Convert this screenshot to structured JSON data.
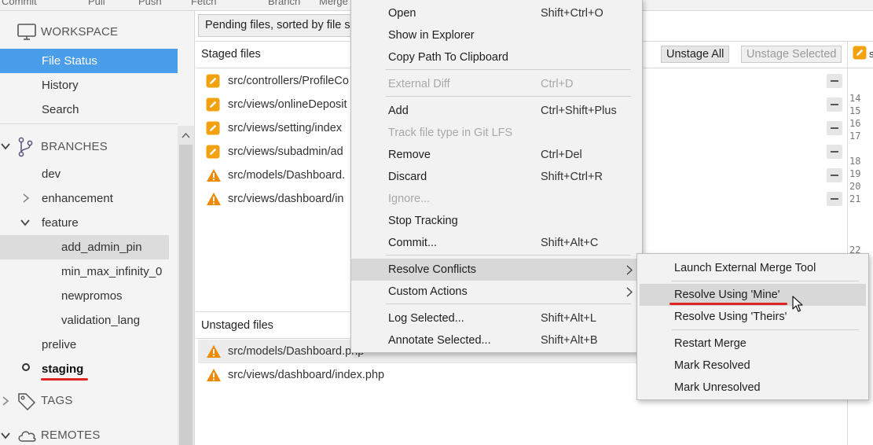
{
  "toolbar": {
    "items": [
      "Commit",
      "Pull",
      "Push",
      "Fetch",
      "Branch",
      "Merge"
    ]
  },
  "sidebar": {
    "workspace": {
      "label": "WORKSPACE",
      "items": [
        "File Status",
        "History",
        "Search"
      ],
      "selected": "File Status"
    },
    "branches": {
      "label": "BRANCHES",
      "items": {
        "dev": "dev",
        "enhancement": "enhancement",
        "feature": "feature",
        "feature_children": [
          "add_admin_pin",
          "min_max_infinity_0",
          "newpromos",
          "validation_lang"
        ],
        "prelive": "prelive",
        "staging": "staging"
      },
      "current": "staging"
    },
    "tags": {
      "label": "TAGS"
    },
    "remotes": {
      "label": "REMOTES"
    }
  },
  "main": {
    "filter_label": "Pending files, sorted by file s",
    "staged": {
      "title": "Staged files",
      "unstage_all": "Unstage All",
      "unstage_selected": "Unstage Selected",
      "files": [
        {
          "path": "src/controllers/ProfileCo",
          "status": "modified"
        },
        {
          "path": "src/views/onlineDeposit",
          "status": "modified"
        },
        {
          "path": "src/views/setting/index",
          "status": "modified"
        },
        {
          "path": "src/views/subadmin/ad",
          "status": "modified"
        },
        {
          "path": "src/models/Dashboard.",
          "status": "conflict"
        },
        {
          "path": "src/views/dashboard/in",
          "status": "conflict"
        }
      ]
    },
    "unstaged": {
      "title": "Unstaged files",
      "files": [
        {
          "path": "src/models/Dashboard.php",
          "status": "conflict"
        },
        {
          "path": "src/views/dashboard/index.php",
          "status": "conflict"
        }
      ]
    },
    "diff_line_numbers": [
      "14",
      "15",
      "16",
      "17",
      "18",
      "19",
      "20",
      "21",
      "22"
    ],
    "diff_header_glyph": "s"
  },
  "context_menu": {
    "items": [
      {
        "label": "Open",
        "shortcut": "Shift+Ctrl+O",
        "enabled": true
      },
      {
        "label": "Show in Explorer",
        "shortcut": "",
        "enabled": true
      },
      {
        "label": "Copy Path To Clipboard",
        "shortcut": "",
        "enabled": true
      },
      {
        "label": "External Diff",
        "shortcut": "Ctrl+D",
        "enabled": false
      },
      {
        "label": "Add",
        "shortcut": "Ctrl+Shift+Plus",
        "enabled": true
      },
      {
        "label": "Track file type in Git LFS",
        "shortcut": "",
        "enabled": false
      },
      {
        "label": "Remove",
        "shortcut": "Ctrl+Del",
        "enabled": true
      },
      {
        "label": "Discard",
        "shortcut": "Shift+Ctrl+R",
        "enabled": true
      },
      {
        "label": "Ignore...",
        "shortcut": "",
        "enabled": false
      },
      {
        "label": "Stop Tracking",
        "shortcut": "",
        "enabled": true
      },
      {
        "label": "Commit...",
        "shortcut": "Shift+Alt+C",
        "enabled": true
      },
      {
        "label": "Resolve Conflicts",
        "shortcut": "",
        "enabled": true,
        "submenu": true,
        "highlighted": true
      },
      {
        "label": "Custom Actions",
        "shortcut": "",
        "enabled": true,
        "submenu": true
      },
      {
        "label": "Log Selected...",
        "shortcut": "Shift+Alt+L",
        "enabled": true
      },
      {
        "label": "Annotate Selected...",
        "shortcut": "Shift+Alt+B",
        "enabled": true
      }
    ]
  },
  "resolve_submenu": {
    "items": [
      {
        "label": "Launch External Merge Tool"
      },
      {
        "label": "Resolve Using 'Mine'",
        "highlighted": true
      },
      {
        "label": "Resolve Using 'Theirs'"
      },
      {
        "label": "Restart Merge"
      },
      {
        "label": "Mark Resolved"
      },
      {
        "label": "Mark Unresolved"
      }
    ]
  },
  "colors": {
    "selection_blue": "#4a9de8",
    "modified_orange": "#f2a10f",
    "conflict_orange": "#f08a00",
    "annotation_red": "#e02424"
  }
}
